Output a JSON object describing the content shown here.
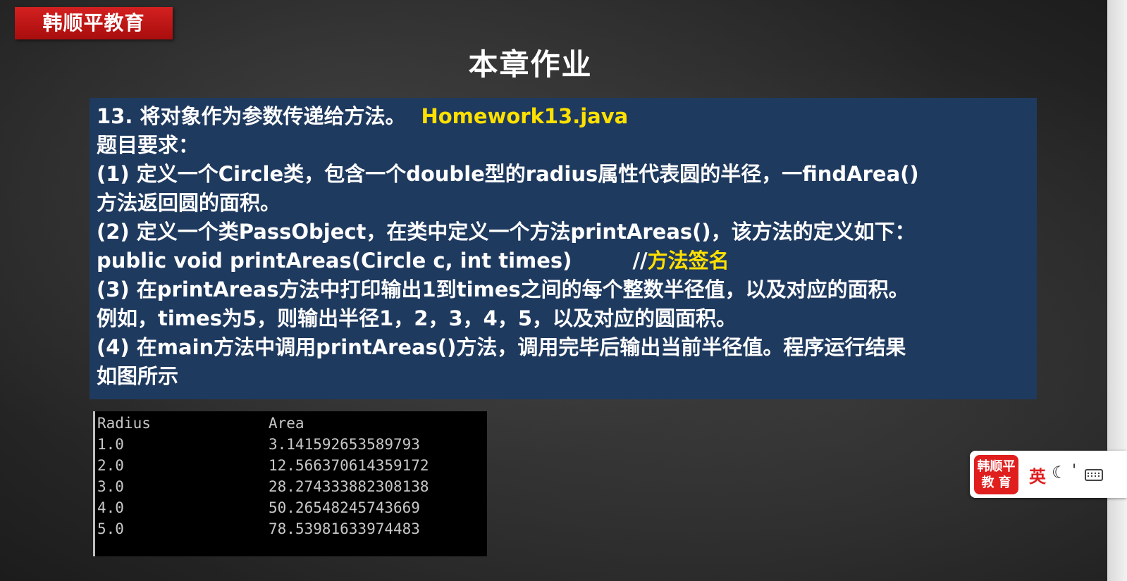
{
  "brand": {
    "label": "韩顺平教育"
  },
  "title": "本章作业",
  "task": {
    "heading": "13. 将对象作为参数传递给方法。",
    "file": "Homework13.java",
    "requirements_label": "题目要求：",
    "req1_line1": "(1) 定义一个Circle类，包含一个double型的radius属性代表圆的半径，一findArea()",
    "req1_line2": "方法返回圆的面积。",
    "req2_line1": "(2) 定义一个类PassObject，在类中定义一个方法printAreas()，该方法的定义如下：",
    "signature": "public void printAreas(Circle c, int times)",
    "comment_slashes": "//",
    "comment_text": "方法签名",
    "req3_line1": "(3) 在printAreas方法中打印输出1到times之间的每个整数半径值，以及对应的面积。",
    "req3_line2": "例如，times为5，则输出半径1，2，3，4，5，以及对应的圆面积。",
    "req4_line1": "(4) 在main方法中调用printAreas()方法，调用完毕后输出当前半径值。程序运行结果",
    "req4_line2": "如图所示"
  },
  "console": {
    "headers": [
      "Radius",
      "Area"
    ],
    "rows": [
      [
        "1.0",
        "3.141592653589793"
      ],
      [
        "2.0",
        "12.566370614359172"
      ],
      [
        "3.0",
        "28.274333882308138"
      ],
      [
        "4.0",
        "50.26548245743669"
      ],
      [
        "5.0",
        "78.53981633974483"
      ]
    ]
  },
  "ime": {
    "logo_line1": "韩顺平",
    "logo_line2": "教育",
    "lang": "英",
    "moon": "☾",
    "punct": "'",
    "keyboard_icon": "keyboard-icon"
  },
  "colors": {
    "panel_bg": "#1f3a5f",
    "highlight": "#ffe000",
    "brand_red": "#d42020"
  }
}
